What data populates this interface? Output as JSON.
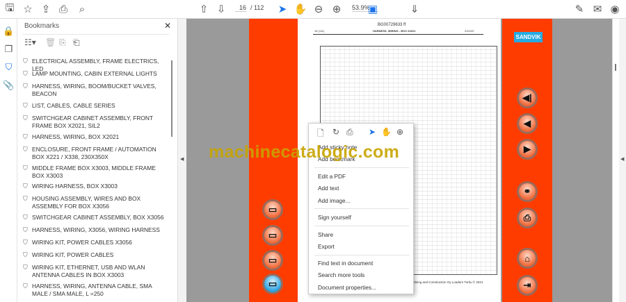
{
  "toolbar": {
    "page_current": "16",
    "page_total": "/ 112",
    "zoom": "53.9%"
  },
  "panel": {
    "title": "Bookmarks",
    "close": "✕"
  },
  "bookmarks": [
    "ELECTRICAL ASSEMBLY, FRAME ELECTRICS, LED",
    "LAMP MOUNTING, CABIN EXTERNAL LIGHTS",
    "HARNESS, WIRING, BOOM/BUCKET VALVES, BEACON",
    "LIST, CABLES, CABLE SERIES",
    "SWITCHGEAR CABINET ASSEMBLY, FRONT FRAME BOX X2021, SIL2",
    "HARNESS, WIRING, BOX X2021",
    "ENCLOSURE, FRONT FRAME / AUTOMATION BOX X221 / X338, 230X350X",
    "MIDDLE FRAME BOX X3003, MIDDLE FRAME BOX X3003",
    "WIRING HARNESS, BOX X3003",
    "HOUSING ASSEMBLY, WIRES AND BOX ASSEMBLY FOR BOX X3056",
    "SWITCHGEAR CABINET ASSEMBLY, BOX X3056",
    "HARNESS, WIRING, X3056, WIRING HARNESS",
    "WIRING KIT, POWER CABLES X3056",
    "WIRING KIT, POWER CABLES",
    "WIRING KIT, ETHERNET, USB AND WLAN ANTENNA CABLES IN BOX X3003",
    "HARNESS, WIRING, ANTENNA CABLE, SMA MALE / SMA MALE, L =250"
  ],
  "document": {
    "doc_number": "BG00729633 ff",
    "page_ref": "16 (111)",
    "sheet_title": "HARNESS, WIRING - BOX X2021",
    "date": "2/10/20",
    "brand": "SANDVIK",
    "footer": "Mining and Construction Oy Loaders Turku © 2021"
  },
  "watermark": "machinecatalogic.com",
  "context_menu": {
    "items": [
      "Add sticky note",
      "Add bookmark",
      "Edit a PDF",
      "Add text",
      "Add image...",
      "Sign yourself",
      "Share",
      "Export",
      "Find text in document",
      "Search more tools",
      "Document properties..."
    ]
  }
}
